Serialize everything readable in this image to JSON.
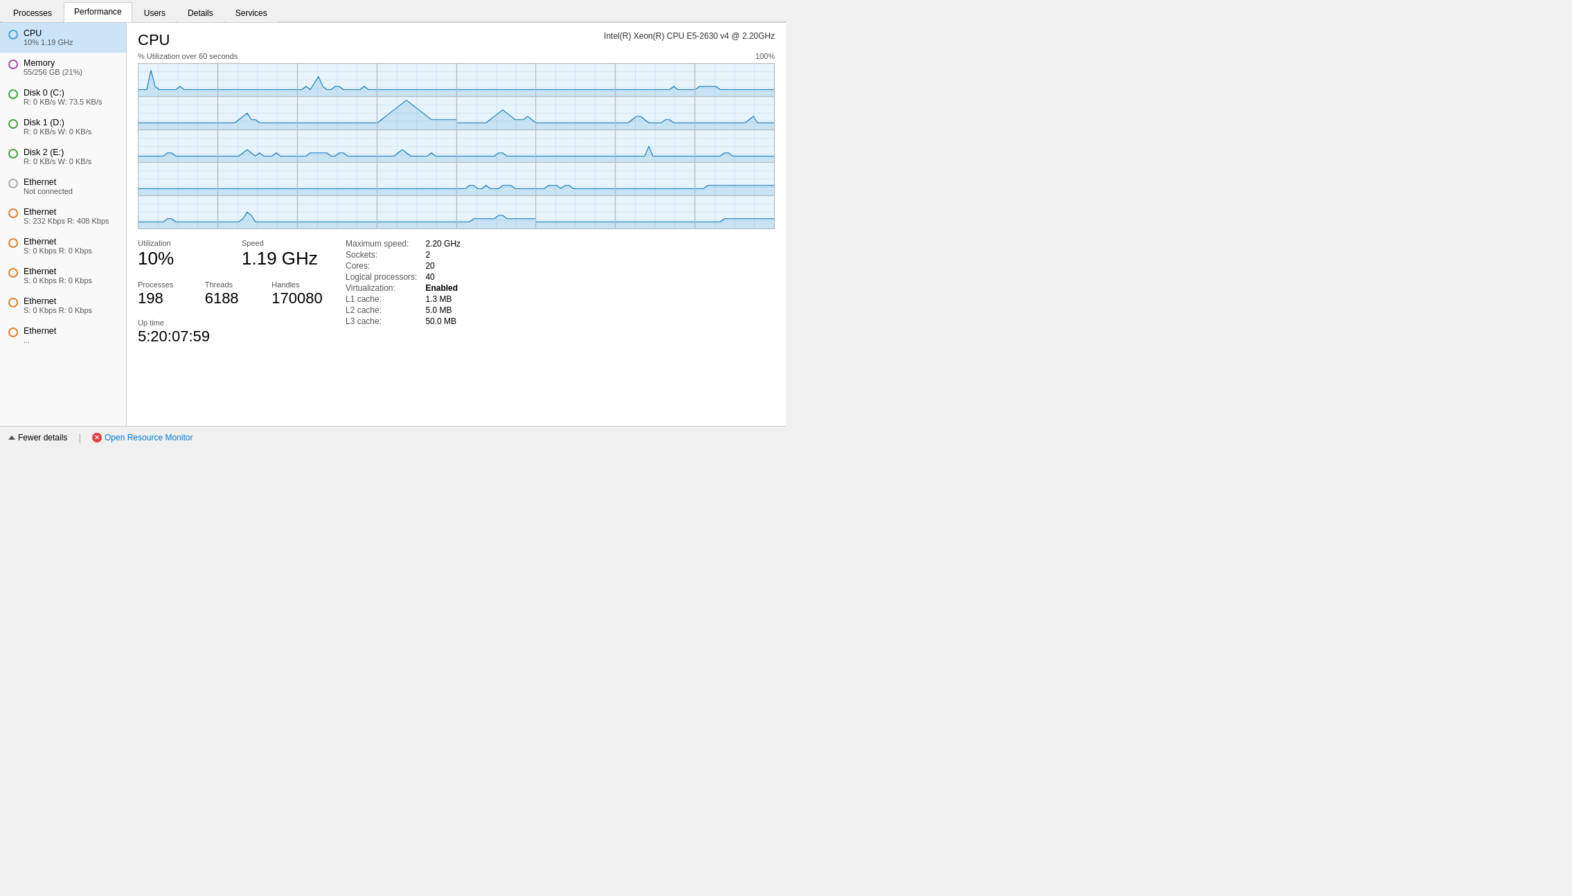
{
  "tabs": [
    {
      "id": "processes",
      "label": "Processes",
      "active": false
    },
    {
      "id": "performance",
      "label": "Performance",
      "active": true
    },
    {
      "id": "users",
      "label": "Users",
      "active": false
    },
    {
      "id": "details",
      "label": "Details",
      "active": false
    },
    {
      "id": "services",
      "label": "Services",
      "active": false
    }
  ],
  "sidebar": {
    "items": [
      {
        "id": "cpu",
        "label": "CPU",
        "detail": "10% 1.19 GHz",
        "indicator": "blue",
        "active": true
      },
      {
        "id": "memory",
        "label": "Memory",
        "detail": "55/256 GB (21%)",
        "indicator": "purple",
        "active": false
      },
      {
        "id": "disk0",
        "label": "Disk 0 (C:)",
        "detail": "R: 0 KB/s  W: 73.5 KB/s",
        "indicator": "green",
        "active": false
      },
      {
        "id": "disk1",
        "label": "Disk 1 (D:)",
        "detail": "R: 0 KB/s  W: 0 KB/s",
        "indicator": "green2",
        "active": false
      },
      {
        "id": "disk2",
        "label": "Disk 2 (E:)",
        "detail": "R: 0 KB/s  W: 0 KB/s",
        "indicator": "green3",
        "active": false
      },
      {
        "id": "ethernet-nc",
        "label": "Ethernet",
        "detail": "Not connected",
        "indicator": "gray",
        "active": false
      },
      {
        "id": "ethernet1",
        "label": "Ethernet",
        "detail": "S: 232 Kbps  R: 408 Kbps",
        "indicator": "orange",
        "active": false
      },
      {
        "id": "ethernet2",
        "label": "Ethernet",
        "detail": "S: 0 Kbps  R: 0 Kbps",
        "indicator": "orange",
        "active": false
      },
      {
        "id": "ethernet3",
        "label": "Ethernet",
        "detail": "S: 0 Kbps  R: 0 Kbps",
        "indicator": "orange",
        "active": false
      },
      {
        "id": "ethernet4",
        "label": "Ethernet",
        "detail": "S: 0 Kbps  R: 0 Kbps",
        "indicator": "orange",
        "active": false
      },
      {
        "id": "ethernet5",
        "label": "Ethernet",
        "detail": "...",
        "indicator": "orange",
        "active": false
      }
    ]
  },
  "content": {
    "cpu_title": "CPU",
    "cpu_model": "Intel(R) Xeon(R) CPU E5-2630 v4 @ 2.20GHz",
    "utilization_label": "% Utilization over 60 seconds",
    "utilization_max": "100%",
    "stats": {
      "utilization_label": "Utilization",
      "utilization_value": "10%",
      "speed_label": "Speed",
      "speed_value": "1.19 GHz",
      "processes_label": "Processes",
      "processes_value": "198",
      "threads_label": "Threads",
      "threads_value": "6188",
      "handles_label": "Handles",
      "handles_value": "170080",
      "uptime_label": "Up time",
      "uptime_value": "5:20:07:59"
    },
    "specs": {
      "max_speed_label": "Maximum speed:",
      "max_speed_value": "2.20 GHz",
      "sockets_label": "Sockets:",
      "sockets_value": "2",
      "cores_label": "Cores:",
      "cores_value": "20",
      "logical_label": "Logical processors:",
      "logical_value": "40",
      "virt_label": "Virtualization:",
      "virt_value": "Enabled",
      "l1_label": "L1 cache:",
      "l1_value": "1.3 MB",
      "l2_label": "L2 cache:",
      "l2_value": "5.0 MB",
      "l3_label": "L3 cache:",
      "l3_value": "50.0 MB"
    }
  },
  "bottom": {
    "fewer_details_label": "Fewer details",
    "open_monitor_label": "Open Resource Monitor"
  }
}
